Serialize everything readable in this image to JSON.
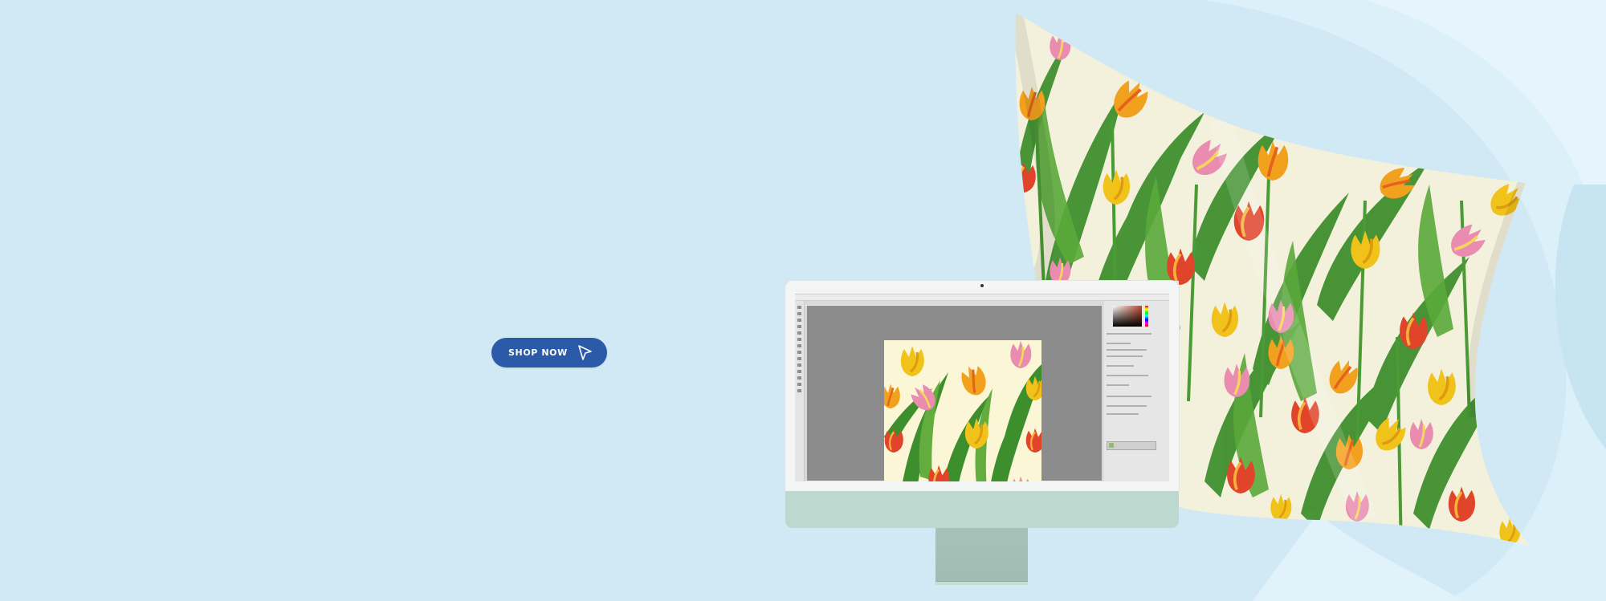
{
  "page": {
    "background": "#d0e9f5"
  },
  "cta": {
    "label": "SHOP NOW",
    "icon": "cursor-arrow-icon",
    "color": "#2a5aa8"
  },
  "hero": {
    "fabric_pattern": "tulip-pattern",
    "device": "desktop-monitor",
    "app": "image-editor"
  }
}
